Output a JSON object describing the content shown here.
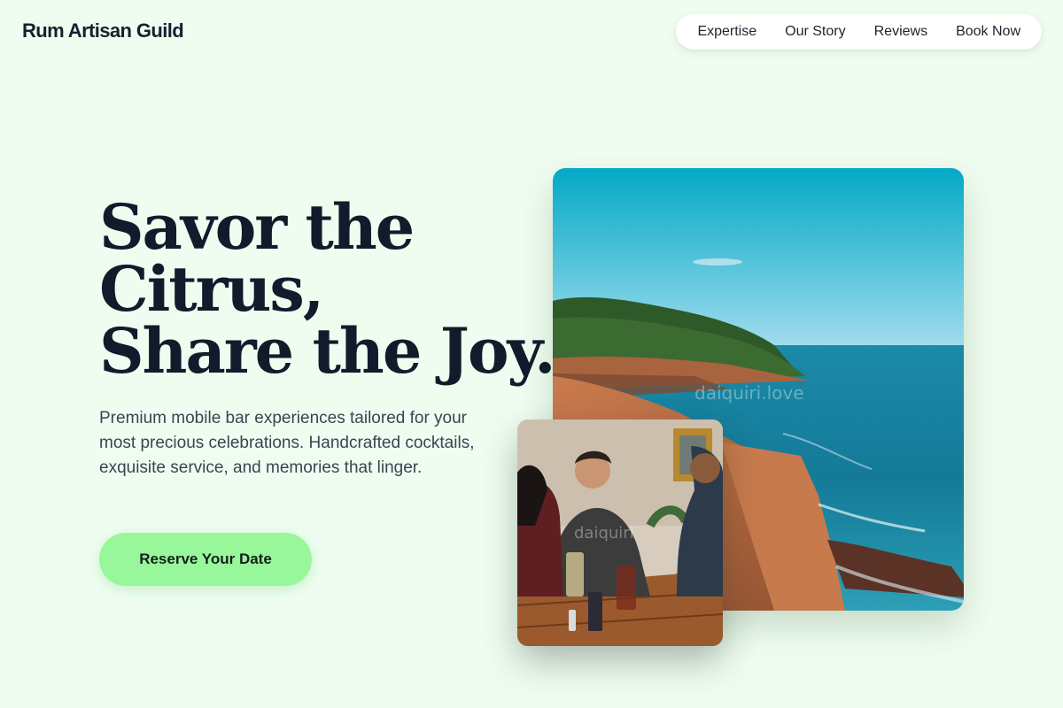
{
  "header": {
    "brand": "Rum Artisan Guild",
    "nav": [
      "Expertise",
      "Our Story",
      "Reviews",
      "Book Now"
    ]
  },
  "hero": {
    "headline_lines": [
      "Savor the",
      "Citrus,",
      "Share the Joy."
    ],
    "lede": "Premium mobile bar experiences tailored for your most precious celebrations. Handcrafted cocktails, exquisite service, and memories that linger.",
    "cta": "Reserve Your Date"
  },
  "images": {
    "coast_watermark": "daiquiri.love",
    "bar_watermark": "daiquiri"
  },
  "colors": {
    "background": "#effdf0",
    "accent": "#98f79a",
    "heading": "#111b2b"
  }
}
